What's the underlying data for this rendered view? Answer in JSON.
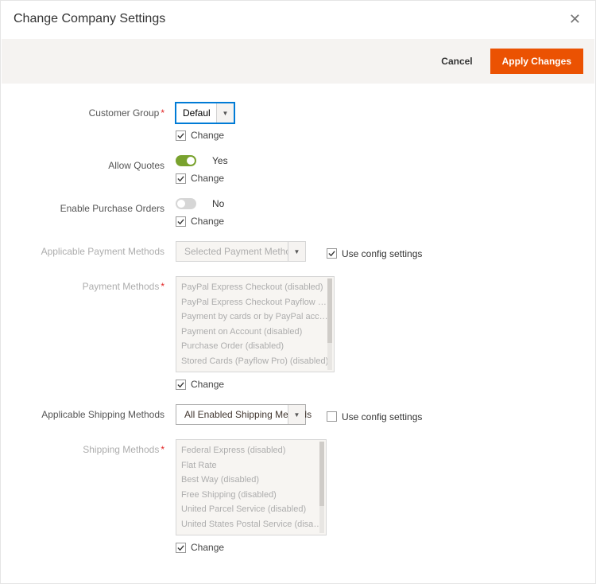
{
  "header": {
    "title": "Change Company Settings"
  },
  "actions": {
    "cancel": "Cancel",
    "apply": "Apply Changes"
  },
  "labels": {
    "customer_group": "Customer Group",
    "allow_quotes": "Allow Quotes",
    "enable_po": "Enable Purchase Orders",
    "applicable_payment": "Applicable Payment Methods",
    "payment_methods": "Payment Methods",
    "applicable_shipping": "Applicable Shipping Methods",
    "shipping_methods": "Shipping Methods",
    "use_config": "Use config settings",
    "change": "Change"
  },
  "customer_group": {
    "selected": "Default (Ge…"
  },
  "allow_quotes": {
    "value": "Yes"
  },
  "enable_po": {
    "value": "No"
  },
  "applicable_payment": {
    "selected": "Selected Payment Methods",
    "use_config": true
  },
  "payment_methods": {
    "options": [
      "PayPal Express Checkout (disabled)",
      "PayPal Express Checkout Payflow Edition (disabled)",
      "Payment by cards or by PayPal account (disabled)",
      "Payment on Account (disabled)",
      "Purchase Order (disabled)",
      "Stored Cards (Payflow Pro) (disabled)"
    ]
  },
  "applicable_shipping": {
    "selected": "All Enabled Shipping Methods",
    "use_config": false
  },
  "shipping_methods": {
    "options": [
      "Federal Express (disabled)",
      "Flat Rate",
      "Best Way (disabled)",
      "Free Shipping (disabled)",
      "United Parcel Service (disabled)",
      "United States Postal Service (disabled)"
    ]
  }
}
